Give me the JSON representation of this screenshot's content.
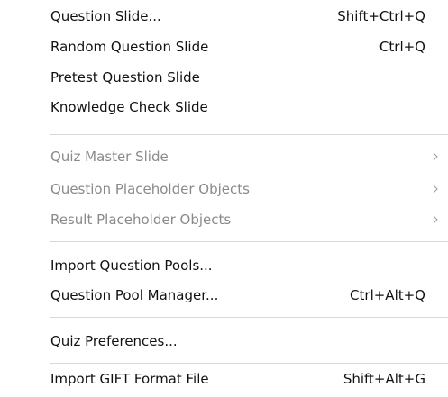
{
  "menu": {
    "items": [
      {
        "label": "Question Slide...",
        "shortcut": "Shift+Ctrl+Q",
        "enabled": true,
        "submenu": false
      },
      {
        "label": "Random Question Slide",
        "shortcut": "Ctrl+Q",
        "enabled": true,
        "submenu": false
      },
      {
        "label": "Pretest Question Slide",
        "shortcut": "",
        "enabled": true,
        "submenu": false
      },
      {
        "label": "Knowledge Check Slide",
        "shortcut": "",
        "enabled": true,
        "submenu": false
      },
      {
        "label": "Quiz Master Slide",
        "shortcut": "",
        "enabled": false,
        "submenu": true
      },
      {
        "label": "Question Placeholder Objects",
        "shortcut": "",
        "enabled": false,
        "submenu": true
      },
      {
        "label": "Result Placeholder Objects",
        "shortcut": "",
        "enabled": false,
        "submenu": true
      },
      {
        "label": "Import Question Pools...",
        "shortcut": "",
        "enabled": true,
        "submenu": false
      },
      {
        "label": "Question Pool Manager...",
        "shortcut": "Ctrl+Alt+Q",
        "enabled": true,
        "submenu": false
      },
      {
        "label": "Quiz Preferences...",
        "shortcut": "",
        "enabled": true,
        "submenu": false
      },
      {
        "label": "Import GIFT Format File",
        "shortcut": "Shift+Alt+G",
        "enabled": true,
        "submenu": false
      }
    ]
  },
  "colors": {
    "text": "#111111",
    "disabled_text": "#8a8a8a",
    "separator": "#d9d9d9",
    "background": "#ffffff"
  },
  "icons": {
    "submenu": "chevron-right-icon"
  }
}
